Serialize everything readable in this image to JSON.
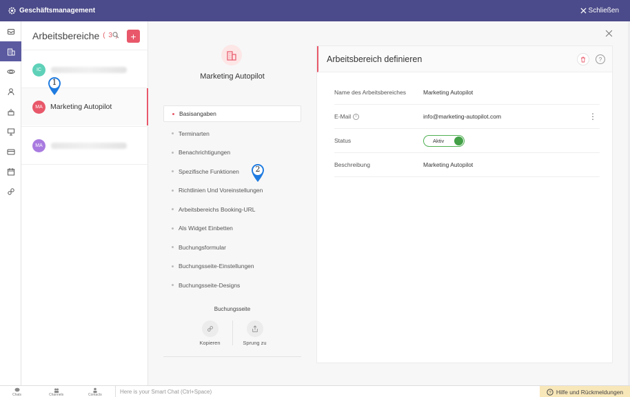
{
  "topbar": {
    "title": "Geschäftsmanagement",
    "close_label": "Schließen"
  },
  "rail": {
    "items": [
      "inbox-icon",
      "building-icon",
      "satellite-icon",
      "user-icon",
      "cake-icon",
      "presentation-icon",
      "card-icon",
      "calendar-icon",
      "link-icon"
    ]
  },
  "workspaces": {
    "title": "Arbeitsbereiche",
    "count": "( 3 )",
    "items": [
      {
        "initials": "IC",
        "name": "",
        "color": "#5fd1b9"
      },
      {
        "initials": "MA",
        "name": "Marketing Autopilot",
        "color": "#e8586a"
      },
      {
        "initials": "MA",
        "name": "",
        "color": "#a97be0"
      }
    ]
  },
  "profile": {
    "name": "Marketing Autopilot"
  },
  "menu": [
    "Basisangaben",
    "Terminarten",
    "Benachrichtigungen",
    "Spezifische Funktionen",
    "Richtlinien Und Voreinstellungen",
    "Arbeitsbereichs Booking-URL",
    "Als Widget Einbetten",
    "Buchungsformular",
    "Buchungsseite-Einstellungen",
    "Buchungsseite-Designs"
  ],
  "booking": {
    "title": "Buchungsseite",
    "copy_label": "Kopieren",
    "goto_label": "Sprung zu"
  },
  "card": {
    "title": "Arbeitsbereich definieren",
    "rows": [
      {
        "label": "Name des Arbeitsbereiches",
        "value": "Marketing Autopilot"
      },
      {
        "label": "E-Mail",
        "value": "info@marketing-autopilot.com"
      },
      {
        "label": "Status",
        "value": "Aktiv"
      },
      {
        "label": "Beschreibung",
        "value": "Marketing Autopilot"
      }
    ]
  },
  "markers": [
    "1",
    "2"
  ],
  "bottombar": {
    "chats": "Chats",
    "channels": "Channels",
    "contacts": "Contacts",
    "chat_placeholder": "Here is your Smart Chat (Ctrl+Space)",
    "help": "Hilfe und Rückmeldungen"
  },
  "colors": {
    "header": "#4b4a8a",
    "accent": "#e8586a",
    "active_rail": "#5b5aa0",
    "toggle_on": "#43a047",
    "marker": "#1f7be0"
  }
}
